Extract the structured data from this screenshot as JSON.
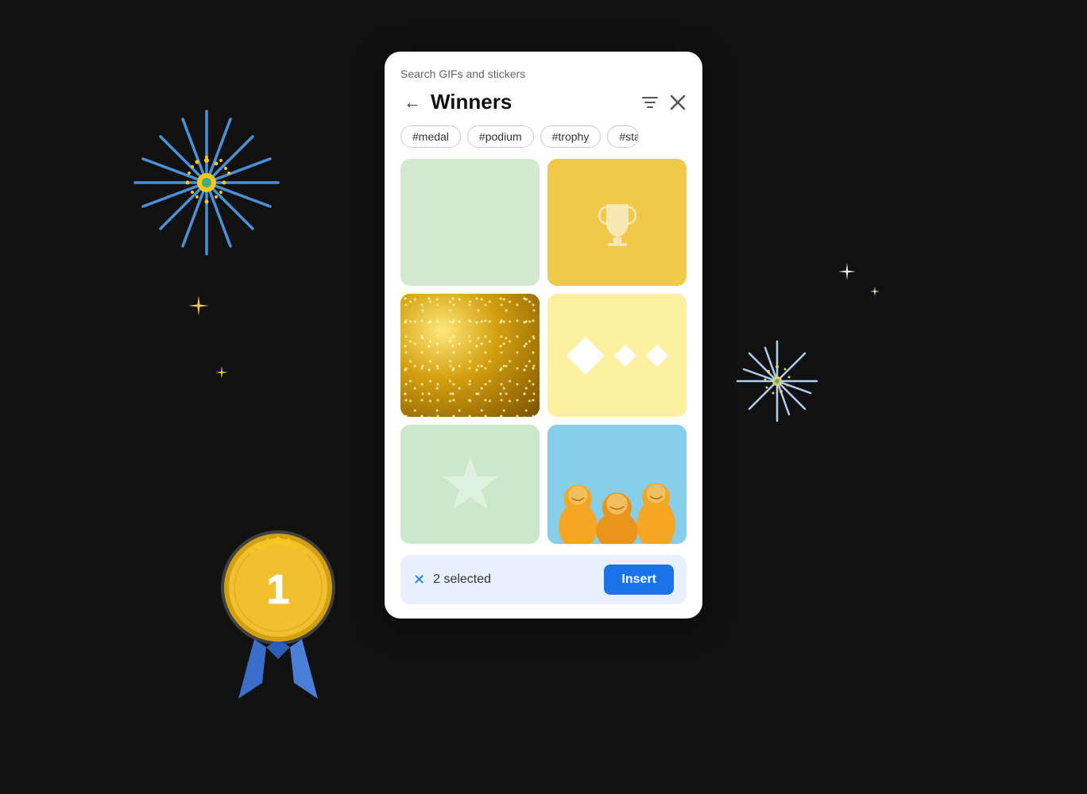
{
  "modal": {
    "search_label": "Search GIFs and stickers",
    "title": "Winners",
    "tags": [
      "#medal",
      "#podium",
      "#trophy",
      "#sta"
    ],
    "grid_items": [
      {
        "id": 1,
        "type": "plain",
        "color": "#d4ead0"
      },
      {
        "id": 2,
        "type": "trophy",
        "color": "#f0c84a"
      },
      {
        "id": 3,
        "type": "glitter",
        "color": "#c9a227"
      },
      {
        "id": 4,
        "type": "sparkles",
        "color": "#fdf0a0"
      },
      {
        "id": 5,
        "type": "star",
        "color": "#cce8cc"
      },
      {
        "id": 6,
        "type": "people",
        "color": "#87ceeb"
      }
    ],
    "bottom_bar": {
      "selected_count": "2 selected",
      "insert_label": "Insert"
    }
  },
  "icons": {
    "back": "←",
    "close": "✕",
    "filter": "⚙",
    "x_blue": "✕"
  }
}
